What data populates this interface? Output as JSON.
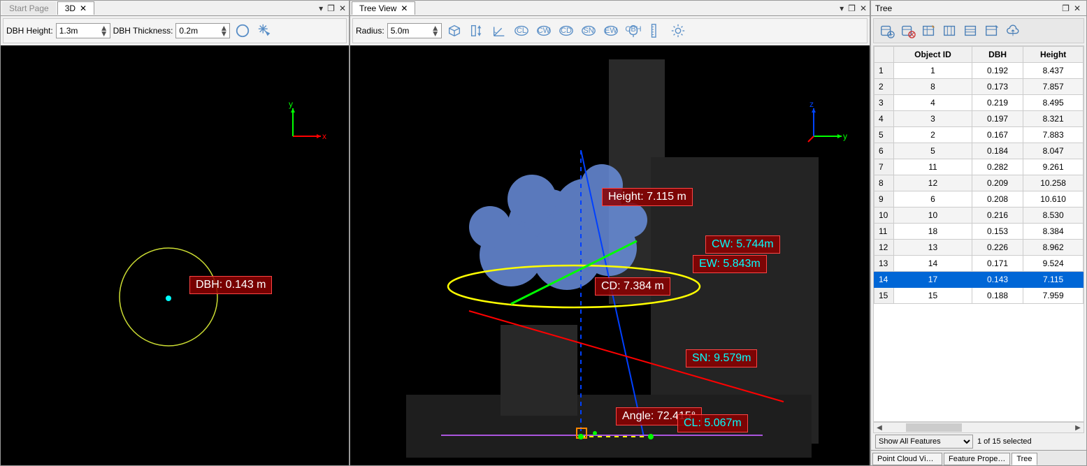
{
  "left_panel": {
    "tabs": [
      {
        "label": "Start Page",
        "active": false,
        "closable": false
      },
      {
        "label": "3D",
        "active": true,
        "closable": true
      }
    ],
    "toolbar": {
      "dbh_height_label": "DBH Height:",
      "dbh_height_value": "1.3m",
      "dbh_thickness_label": "DBH Thickness:",
      "dbh_thickness_value": "0.2m"
    },
    "measurement": {
      "dbh_label": "DBH: 0.143 m"
    }
  },
  "mid_panel": {
    "tabs": [
      {
        "label": "Tree View",
        "active": true,
        "closable": true
      }
    ],
    "toolbar": {
      "radius_label": "Radius:",
      "radius_value": "5.0m",
      "icon_labels": [
        "CL",
        "CW",
        "CD",
        "SN",
        "EW"
      ]
    },
    "measurements": {
      "height": "Height: 7.115 m",
      "cw": "CW: 5.744m",
      "ew": "EW: 5.843m",
      "cd": "CD: 7.384 m",
      "sn": "SN: 9.579m",
      "angle": "Angle: 72.415°",
      "cl": "CL: 5.067m"
    }
  },
  "right_panel": {
    "title": "Tree",
    "table": {
      "headers": [
        "Object ID",
        "DBH",
        "Height"
      ],
      "rows": [
        {
          "n": 1,
          "id": "1",
          "dbh": "0.192",
          "h": "8.437",
          "sel": false
        },
        {
          "n": 2,
          "id": "8",
          "dbh": "0.173",
          "h": "7.857",
          "sel": false
        },
        {
          "n": 3,
          "id": "4",
          "dbh": "0.219",
          "h": "8.495",
          "sel": false
        },
        {
          "n": 4,
          "id": "3",
          "dbh": "0.197",
          "h": "8.321",
          "sel": false
        },
        {
          "n": 5,
          "id": "2",
          "dbh": "0.167",
          "h": "7.883",
          "sel": false
        },
        {
          "n": 6,
          "id": "5",
          "dbh": "0.184",
          "h": "8.047",
          "sel": false
        },
        {
          "n": 7,
          "id": "11",
          "dbh": "0.282",
          "h": "9.261",
          "sel": false
        },
        {
          "n": 8,
          "id": "12",
          "dbh": "0.209",
          "h": "10.258",
          "sel": false
        },
        {
          "n": 9,
          "id": "6",
          "dbh": "0.208",
          "h": "10.610",
          "sel": false
        },
        {
          "n": 10,
          "id": "10",
          "dbh": "0.216",
          "h": "8.530",
          "sel": false
        },
        {
          "n": 11,
          "id": "18",
          "dbh": "0.153",
          "h": "8.384",
          "sel": false
        },
        {
          "n": 12,
          "id": "13",
          "dbh": "0.226",
          "h": "8.962",
          "sel": false
        },
        {
          "n": 13,
          "id": "14",
          "dbh": "0.171",
          "h": "9.524",
          "sel": false
        },
        {
          "n": 14,
          "id": "17",
          "dbh": "0.143",
          "h": "7.115",
          "sel": true
        },
        {
          "n": 15,
          "id": "15",
          "dbh": "0.188",
          "h": "7.959",
          "sel": false
        }
      ]
    },
    "filter": {
      "dropdown": "Show All Features",
      "status": "1 of 15 selected"
    },
    "bottom_tabs": [
      {
        "label": "Point Cloud View M…",
        "active": false
      },
      {
        "label": "Feature Prope…",
        "active": false
      },
      {
        "label": "Tree",
        "active": true
      }
    ]
  }
}
